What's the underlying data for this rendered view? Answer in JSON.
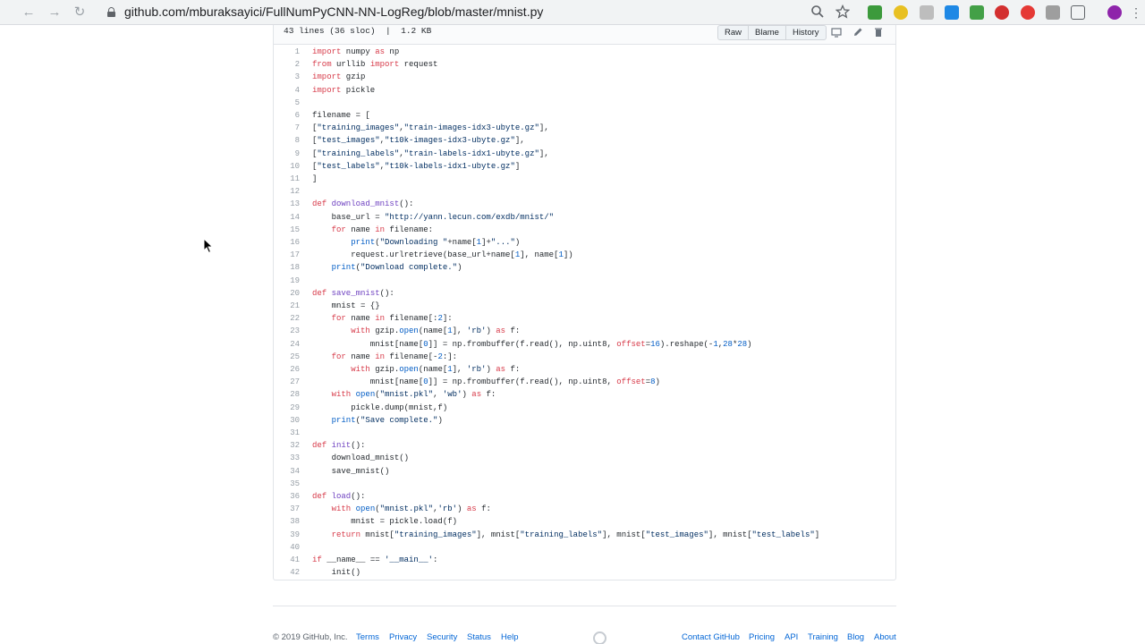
{
  "browser": {
    "url": "github.com/mburaksayici/FullNumPyCNN-NN-LogReg/blob/master/mnist.py",
    "back_icon": "arrow-left-icon",
    "forward_icon": "arrow-right-icon",
    "reload_icon": "reload-icon",
    "lock_icon": "lock-icon"
  },
  "file_header": {
    "info": "43 lines (36 sloc)  |  1.2 KB",
    "buttons": [
      "Raw",
      "Blame",
      "History"
    ]
  },
  "code_lines": [
    {
      "n": "1",
      "t": "import numpy as np"
    },
    {
      "n": "2",
      "t": "from urllib import request"
    },
    {
      "n": "3",
      "t": "import gzip"
    },
    {
      "n": "4",
      "t": "import pickle"
    },
    {
      "n": "5",
      "t": ""
    },
    {
      "n": "6",
      "t": "filename = ["
    },
    {
      "n": "7",
      "t": "[\"training_images\",\"train-images-idx3-ubyte.gz\"],"
    },
    {
      "n": "8",
      "t": "[\"test_images\",\"t10k-images-idx3-ubyte.gz\"],"
    },
    {
      "n": "9",
      "t": "[\"training_labels\",\"train-labels-idx1-ubyte.gz\"],"
    },
    {
      "n": "10",
      "t": "[\"test_labels\",\"t10k-labels-idx1-ubyte.gz\"]"
    },
    {
      "n": "11",
      "t": "]"
    },
    {
      "n": "12",
      "t": ""
    },
    {
      "n": "13",
      "t": "def download_mnist():"
    },
    {
      "n": "14",
      "t": "    base_url = \"http://yann.lecun.com/exdb/mnist/\""
    },
    {
      "n": "15",
      "t": "    for name in filename:"
    },
    {
      "n": "16",
      "t": "        print(\"Downloading \"+name[1]+\"...\")"
    },
    {
      "n": "17",
      "t": "        request.urlretrieve(base_url+name[1], name[1])"
    },
    {
      "n": "18",
      "t": "    print(\"Download complete.\")"
    },
    {
      "n": "19",
      "t": ""
    },
    {
      "n": "20",
      "t": "def save_mnist():"
    },
    {
      "n": "21",
      "t": "    mnist = {}"
    },
    {
      "n": "22",
      "t": "    for name in filename[:2]:"
    },
    {
      "n": "23",
      "t": "        with gzip.open(name[1], 'rb') as f:"
    },
    {
      "n": "24",
      "t": "            mnist[name[0]] = np.frombuffer(f.read(), np.uint8, offset=16).reshape(-1,28*28)"
    },
    {
      "n": "25",
      "t": "    for name in filename[-2:]:"
    },
    {
      "n": "26",
      "t": "        with gzip.open(name[1], 'rb') as f:"
    },
    {
      "n": "27",
      "t": "            mnist[name[0]] = np.frombuffer(f.read(), np.uint8, offset=8)"
    },
    {
      "n": "28",
      "t": "    with open(\"mnist.pkl\", 'wb') as f:"
    },
    {
      "n": "29",
      "t": "        pickle.dump(mnist,f)"
    },
    {
      "n": "30",
      "t": "    print(\"Save complete.\")"
    },
    {
      "n": "31",
      "t": ""
    },
    {
      "n": "32",
      "t": "def init():"
    },
    {
      "n": "33",
      "t": "    download_mnist()"
    },
    {
      "n": "34",
      "t": "    save_mnist()"
    },
    {
      "n": "35",
      "t": ""
    },
    {
      "n": "36",
      "t": "def load():"
    },
    {
      "n": "37",
      "t": "    with open(\"mnist.pkl\",'rb') as f:"
    },
    {
      "n": "38",
      "t": "        mnist = pickle.load(f)"
    },
    {
      "n": "39",
      "t": "    return mnist[\"training_images\"], mnist[\"training_labels\"], mnist[\"test_images\"], mnist[\"test_labels\"]"
    },
    {
      "n": "40",
      "t": ""
    },
    {
      "n": "41",
      "t": "if __name__ == '__main__':"
    },
    {
      "n": "42",
      "t": "    init()"
    }
  ],
  "footer": {
    "copyright": "© 2019 GitHub, Inc.",
    "left_links": [
      "Terms",
      "Privacy",
      "Security",
      "Status",
      "Help"
    ],
    "right_links": [
      "Contact GitHub",
      "Pricing",
      "API",
      "Training",
      "Blog",
      "About"
    ]
  },
  "colors": {
    "keyword": "#d73a49",
    "function": "#6f42c1",
    "string": "#032f62",
    "number": "#005cc5",
    "link": "#0366d6"
  }
}
